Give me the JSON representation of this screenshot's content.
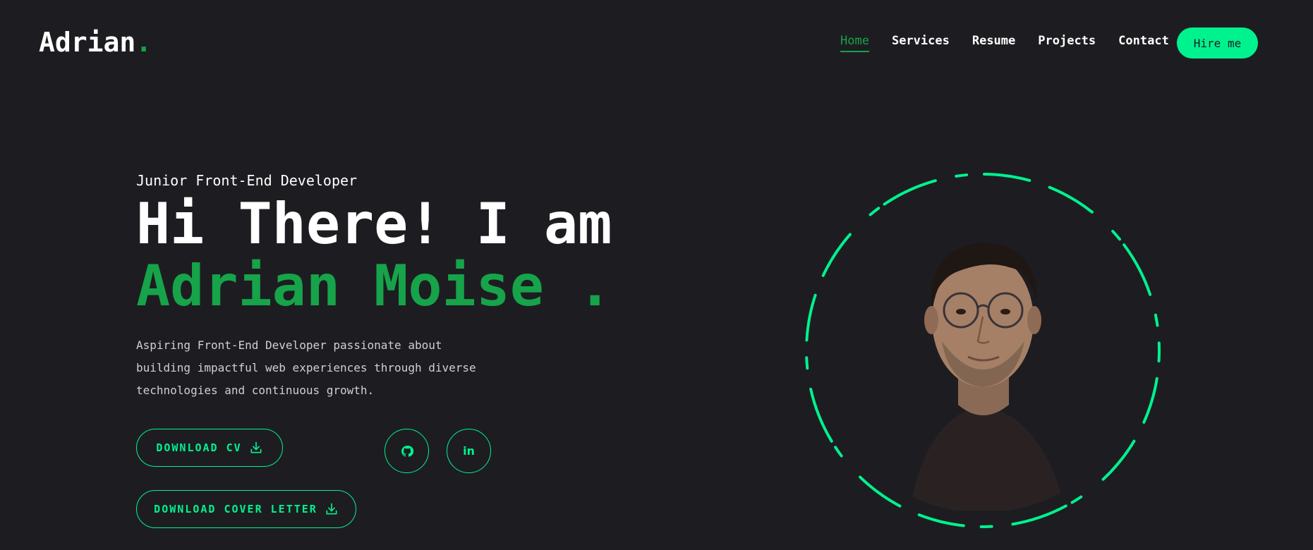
{
  "header": {
    "logo_text": "Adrian",
    "logo_dot": ".",
    "nav": [
      {
        "label": "Home",
        "active": true
      },
      {
        "label": "Services"
      },
      {
        "label": "Resume"
      },
      {
        "label": "Projects"
      },
      {
        "label": "Contact"
      }
    ],
    "hire_label": "Hire me"
  },
  "hero": {
    "subtitle": "Junior Front-End Developer",
    "headline": "Hi There! I am",
    "name": "Adrian Moise .",
    "description": "Aspiring Front-End Developer passionate about building impactful web experiences through diverse technologies and continuous growth.",
    "download_cv_label": "Download CV",
    "download_cover_label": "Download Cover Letter"
  },
  "social": [
    {
      "icon": "github-icon"
    },
    {
      "icon": "linkedin-icon",
      "glyph": "in"
    }
  ],
  "colors": {
    "background": "#1d1d21",
    "accent": "#00f28f",
    "name_green": "#16a34a"
  }
}
